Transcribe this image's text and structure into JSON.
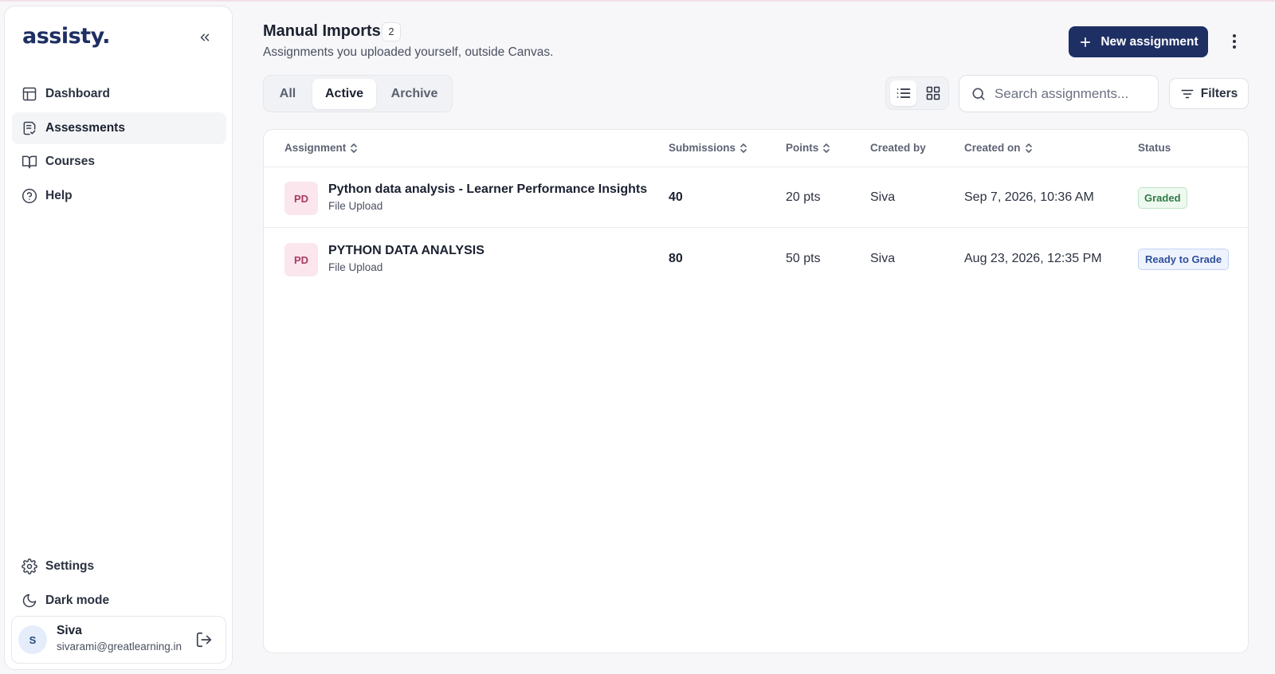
{
  "brand": {
    "logo": "assisty."
  },
  "sidebar": {
    "items": [
      {
        "label": "Dashboard",
        "icon": "dashboard-icon"
      },
      {
        "label": "Assessments",
        "icon": "assessments-icon",
        "active": true
      },
      {
        "label": "Courses",
        "icon": "book-icon"
      },
      {
        "label": "Help",
        "icon": "help-icon"
      }
    ],
    "bottom": [
      {
        "label": "Settings",
        "icon": "gear-icon"
      },
      {
        "label": "Dark mode",
        "icon": "moon-icon"
      }
    ],
    "user": {
      "initial": "S",
      "name": "Siva",
      "email": "sivarami@greatlearning.in"
    }
  },
  "header": {
    "title": "Manual Imports",
    "count": "2",
    "subtitle": "Assignments you uploaded yourself, outside Canvas.",
    "new_button": "New assignment"
  },
  "tabs": [
    {
      "label": "All"
    },
    {
      "label": "Active",
      "selected": true
    },
    {
      "label": "Archive"
    }
  ],
  "search": {
    "placeholder": "Search assignments..."
  },
  "filters_label": "Filters",
  "table": {
    "columns": [
      "Assignment",
      "Submissions",
      "Points",
      "Created by",
      "Created on",
      "Status"
    ],
    "rows": [
      {
        "initials": "PD",
        "title": "Python data analysis - Learner Performance Insights",
        "type": "File Upload",
        "submissions": "40",
        "points": "20 pts",
        "created_by": "Siva",
        "created_on": "Sep 7, 2026, 10:36 AM",
        "status": "Graded"
      },
      {
        "initials": "PD",
        "title": "PYTHON DATA ANALYSIS",
        "type": "File Upload",
        "submissions": "80",
        "points": "50 pts",
        "created_by": "Siva",
        "created_on": "Aug 23, 2026, 12:35 PM",
        "status": "Ready to Grade"
      }
    ]
  },
  "colors": {
    "primary": "#1e2f63",
    "graded": "#2f7a45",
    "ready": "#2f4f9a",
    "thumb_bg": "#fbe6ee",
    "thumb_text": "#a93a63"
  }
}
